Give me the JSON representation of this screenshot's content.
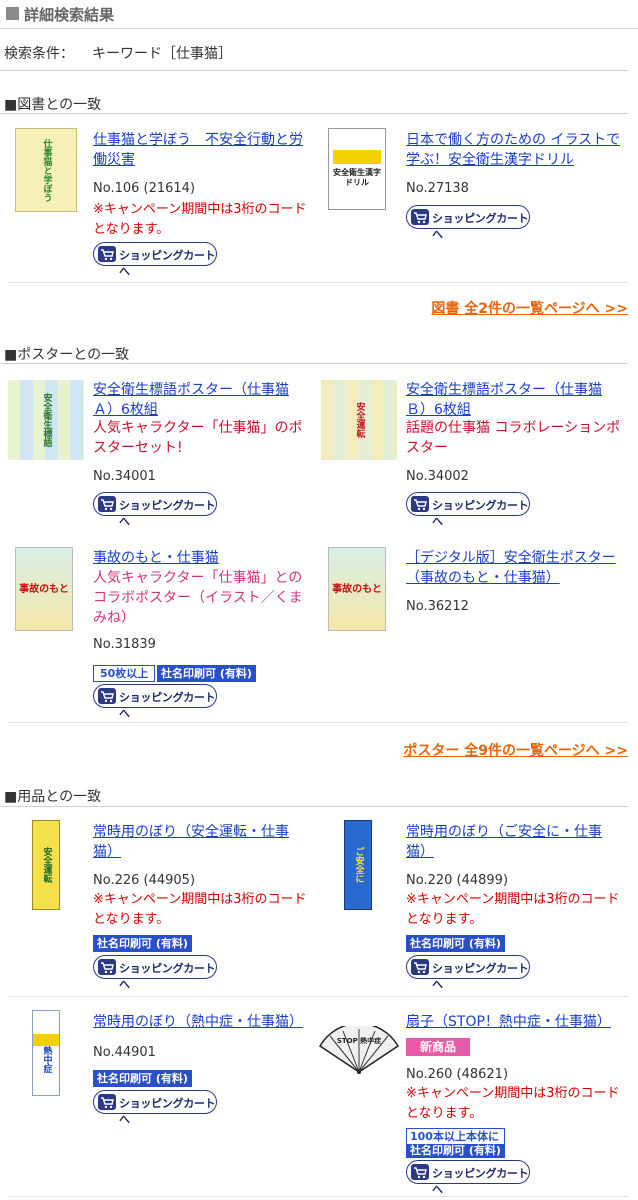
{
  "header": {
    "title": "詳細検索結果"
  },
  "condition": {
    "label": "検索条件：",
    "value": "キーワード［仕事猫］"
  },
  "cart_label": "ショッピングカートへ",
  "sections": {
    "books": {
      "heading": "■図書との一致",
      "more": "図書 全2件の一覧ページへ >>",
      "items": [
        {
          "title": "仕事猫と学ぼう　不安全行動と労働災害",
          "no": "No.106 (21614)",
          "campaign": "※キャンペーン期間中は3桁のコードとなります。"
        },
        {
          "title": "日本で働く方のための イラストで学ぶ！安全衛生漢字ドリル",
          "no": "No.27138"
        }
      ]
    },
    "posters": {
      "heading": "■ポスターとの一致",
      "more": "ポスター 全9件の一覧ページへ >>",
      "items": [
        {
          "title": "安全衛生標語ポスター（仕事猫Ａ）6枚組",
          "subtitle": "人気キャラクター「仕事猫」のポスターセット!",
          "no": "No.34001"
        },
        {
          "title": "安全衛生標語ポスター（仕事猫Ｂ）6枚組",
          "subtitle": "話題の仕事猫 コラボレーションポスター",
          "no": "No.34002"
        },
        {
          "title": "事故のもと・仕事猫",
          "subtitle": "人気キャラクター「仕事猫」とのコラボポスター（イラスト／くまみね）",
          "no": "No.31839",
          "badge_left": "50枚以上",
          "badge_right": "社名印刷可 (有料)"
        },
        {
          "title": "［デジタル版］安全衛生ポスター（事故のもと・仕事猫）",
          "no": "No.36212"
        }
      ]
    },
    "goods": {
      "heading": "■用品との一致",
      "items": [
        {
          "title": "常時用のぼり（安全運転・仕事猫）",
          "no": "No.226 (44905)",
          "campaign": "※キャンペーン期間中は3桁のコードとなります。",
          "badge": "社名印刷可 (有料)"
        },
        {
          "title": "常時用のぼり（ご安全に・仕事猫）",
          "no": "No.220 (44899)",
          "campaign": "※キャンペーン期間中は3桁のコードとなります。",
          "badge": "社名印刷可 (有料)"
        },
        {
          "title": "常時用のぼり（熱中症・仕事猫）",
          "no": "No.44901",
          "badge": "社名印刷可 (有料)"
        },
        {
          "title": "扇子（STOP！熱中症・仕事猫）",
          "new_badge": "新商品",
          "no": "No.260 (48621)",
          "campaign": "※キャンペーン期間中は3桁のコードとなります。",
          "badge_line1": "100本以上本体に",
          "badge_line2": "社名印刷可 (有料)"
        }
      ]
    }
  },
  "thumbs": {
    "book1": "仕事猫と学ぼう",
    "book2": "安全衛生漢字ドリル",
    "poster1": "安全衛生標語",
    "poster2": "安全運転",
    "poster3": "事故のもと",
    "poster4": "事故のもと",
    "flag1": "安全運転",
    "flag2": "ご安全に",
    "flag3": "熱中症",
    "fan": "STOP 熱中症"
  },
  "colors": {
    "link": "#1a3fc9",
    "red": "#c8102e",
    "orange": "#e8640c",
    "badge_blue": "#2950c8",
    "new_pink": "#e95aa6"
  }
}
